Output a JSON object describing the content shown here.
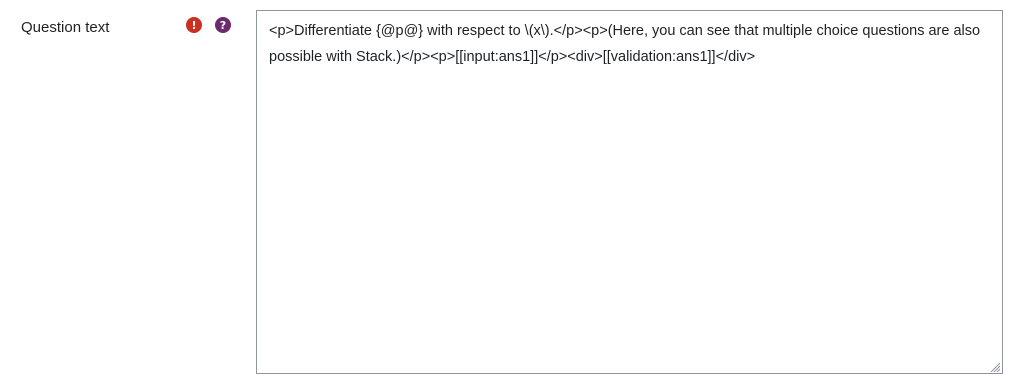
{
  "field": {
    "label": "Question text",
    "required_icon": "exclamation-icon",
    "help_icon": "question-icon",
    "required_glyph": "!",
    "help_glyph": "?"
  },
  "editor": {
    "value": "<p>Differentiate {@p@} with respect to \\(x\\).</p><p>(Here, you can see that multiple choice questions are also possible with Stack.)</p><p>[[input:ans1]]</p><div>[[validation:ans1]]</div>"
  },
  "colors": {
    "required": "#ca3120",
    "help": "#6c2b6e",
    "border": "#8f959e"
  }
}
